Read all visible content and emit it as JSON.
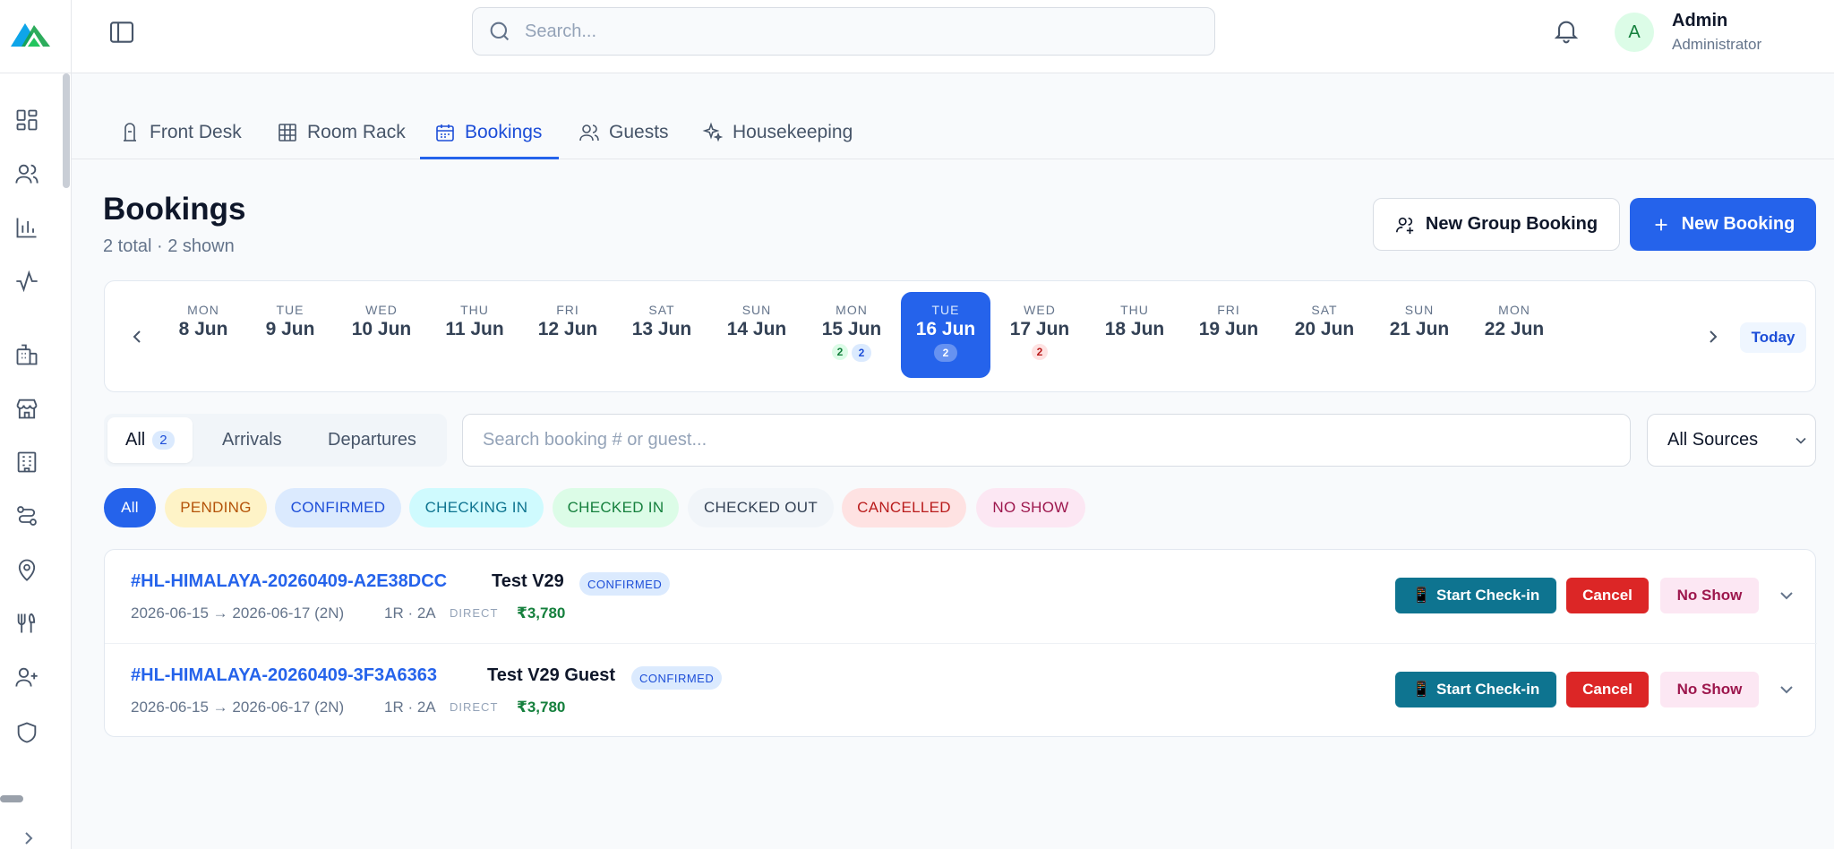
{
  "header": {
    "search_placeholder": "Search...",
    "user": {
      "initial": "A",
      "name": "Admin",
      "role": "Administrator"
    }
  },
  "tabs": [
    {
      "label": "Front Desk",
      "icon": "bell-desk-icon"
    },
    {
      "label": "Room Rack",
      "icon": "grid-icon"
    },
    {
      "label": "Bookings",
      "icon": "calendar-icon",
      "active": true
    },
    {
      "label": "Guests",
      "icon": "users-icon"
    },
    {
      "label": "Housekeeping",
      "icon": "sparkles-icon"
    }
  ],
  "page": {
    "title": "Bookings",
    "subtitle": "2 total · 2 shown",
    "group_booking_label": "New Group Booking",
    "new_booking_label": "New Booking"
  },
  "date_strip": {
    "today_label": "Today",
    "days": [
      {
        "dow": "MON",
        "date": "8 Jun"
      },
      {
        "dow": "TUE",
        "date": "9 Jun"
      },
      {
        "dow": "WED",
        "date": "10 Jun"
      },
      {
        "dow": "THU",
        "date": "11 Jun"
      },
      {
        "dow": "FRI",
        "date": "12 Jun"
      },
      {
        "dow": "SAT",
        "date": "13 Jun"
      },
      {
        "dow": "SUN",
        "date": "14 Jun"
      },
      {
        "dow": "MON",
        "date": "15 Jun",
        "arrivals": "2",
        "stays": "2"
      },
      {
        "dow": "TUE",
        "date": "16 Jun",
        "stays": "2",
        "active": true
      },
      {
        "dow": "WED",
        "date": "17 Jun",
        "departures": "2"
      },
      {
        "dow": "THU",
        "date": "18 Jun"
      },
      {
        "dow": "FRI",
        "date": "19 Jun"
      },
      {
        "dow": "SAT",
        "date": "20 Jun"
      },
      {
        "dow": "SUN",
        "date": "21 Jun"
      },
      {
        "dow": "MON",
        "date": "22 Jun"
      }
    ]
  },
  "filters": {
    "segments": {
      "all": "All",
      "all_count": "2",
      "arrivals": "Arrivals",
      "departures": "Departures"
    },
    "search_placeholder": "Search booking # or guest...",
    "source_select": "All Sources",
    "status_chips": [
      {
        "label": "All",
        "bg": "#2563eb",
        "fg": "#ffffff"
      },
      {
        "label": "PENDING",
        "bg": "#fef3c7",
        "fg": "#b45309"
      },
      {
        "label": "CONFIRMED",
        "bg": "#dbeafe",
        "fg": "#1d4ed8"
      },
      {
        "label": "CHECKING IN",
        "bg": "#cffafe",
        "fg": "#0e7490"
      },
      {
        "label": "CHECKED IN",
        "bg": "#dcfce7",
        "fg": "#15803d"
      },
      {
        "label": "CHECKED OUT",
        "bg": "#f1f5f9",
        "fg": "#334155"
      },
      {
        "label": "CANCELLED",
        "bg": "#fee2e2",
        "fg": "#b91c1c"
      },
      {
        "label": "NO SHOW",
        "bg": "#fce7f3",
        "fg": "#9d174d"
      }
    ]
  },
  "bookings": [
    {
      "id": "#HL-HIMALAYA-20260409-A2E38DCC",
      "guest": "Test V29",
      "status": "CONFIRMED",
      "dates": "2026-06-15 → 2026-06-17 (2N)",
      "rooms": "1R · 2A",
      "source": "DIRECT",
      "amount": "₹3,780",
      "actions": {
        "checkin": "Start Check-in",
        "checkin_icon": "📱",
        "cancel": "Cancel",
        "noshow": "No Show"
      }
    },
    {
      "id": "#HL-HIMALAYA-20260409-3F3A6363",
      "guest": "Test V29 Guest",
      "status": "CONFIRMED",
      "dates": "2026-06-15 → 2026-06-17 (2N)",
      "rooms": "1R · 2A",
      "source": "DIRECT",
      "amount": "₹3,780",
      "actions": {
        "checkin": "Start Check-in",
        "checkin_icon": "📱",
        "cancel": "Cancel",
        "noshow": "No Show"
      }
    }
  ],
  "colors": {
    "primary": "#2563eb",
    "checkin": "#0e7490",
    "cancel": "#dc2626",
    "amount": "#15803d"
  }
}
